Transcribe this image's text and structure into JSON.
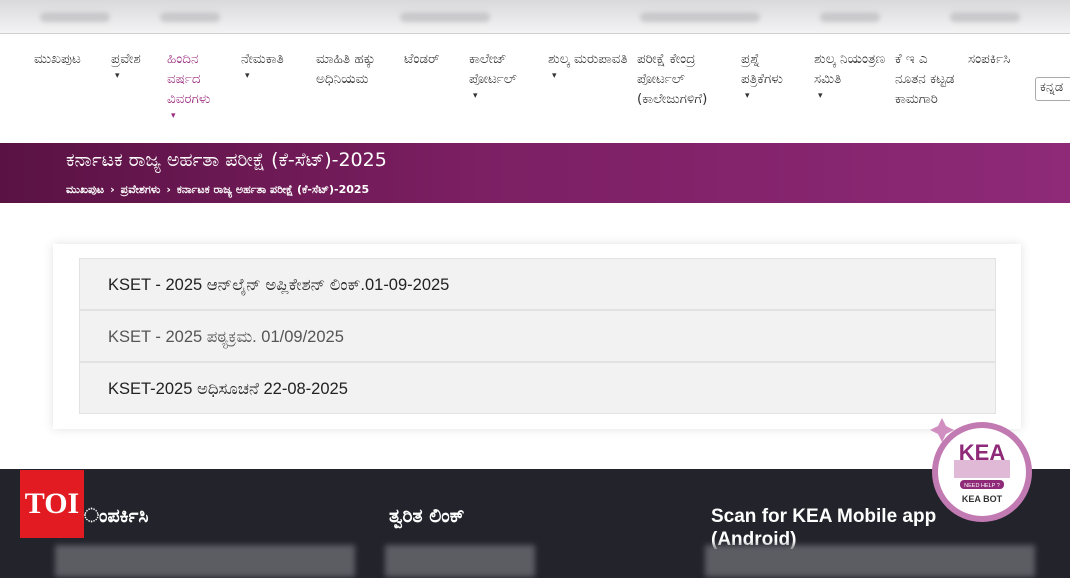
{
  "nav": {
    "items": [
      {
        "label": "ಮುಖಪುಟ",
        "caret": false
      },
      {
        "label": "ಪ್ರವೇಶ",
        "caret": true
      },
      {
        "label": "ಹಿಂದಿನ ವರ್ಷದ ವಿವರಗಳು",
        "caret": true
      },
      {
        "label": "ನೇಮಕಾತಿ",
        "caret": true
      },
      {
        "label": "ಮಾಹಿತಿ ಹಕ್ಕು ಅಧಿನಿಯಮ",
        "caret": false
      },
      {
        "label": "ಟೆಂಡರ್",
        "caret": false
      },
      {
        "label": "ಕಾಲೇಜ್ ಪೋರ್ಟಲ್",
        "caret": true
      },
      {
        "label": "ಶುಲ್ಕ ಮರುಪಾವತಿ",
        "caret": true
      },
      {
        "label": "ಪರೀಕ್ಷೆ ಕೇಂದ್ರ ಪೋರ್ಟಲ್ (ಕಾಲೇಜುಗಳಿಗೆ)",
        "caret": false
      },
      {
        "label": "ಪ್ರಶ್ನೆ ಪತ್ರಿಕೆಗಳು",
        "caret": true
      },
      {
        "label": "ಶುಲ್ಕ ನಿಯಂತ್ರಣ ಸಮಿತಿ",
        "caret": true
      },
      {
        "label": "ಕೆ ಇ ಎ ನೂತನ ಕಟ್ಟಡ ಕಾಮಗಾರಿ",
        "caret": false
      },
      {
        "label": "ಸಂಪರ್ಕಿಸಿ",
        "caret": false
      }
    ],
    "caret_glyph": "▾",
    "language_select": "ಕನ್ನಡ"
  },
  "banner": {
    "title": "ಕರ್ನಾಟಕ ರಾಜ್ಯ ಅರ್ಹತಾ ಪರೀಕ್ಷೆ (ಕೆ-ಸೆಟ್)-2025",
    "breadcrumb": [
      "ಮುಖಪುಟ",
      "ಪ್ರವೇಶಗಳು",
      "ಕರ್ನಾಟಕ ರಾಜ್ಯ ಅರ್ಹತಾ ಪರೀಕ್ಷೆ (ಕೆ-ಸೆಟ್)-2025"
    ],
    "breadcrumb_sep": "›"
  },
  "links": [
    "KSET - 2025 ಆನ್‌ಲೈನ್ ಅಪ್ಲಿಕೇಶನ್ ಲಿಂಕ್.01-09-2025",
    "KSET - 2025 ಪಠ್ಯಕ್ರಮ. 01/09/2025",
    "KSET-2025 ಅಧಿಸೂಚನೆ 22-08-2025"
  ],
  "footer": {
    "contact_heading": "ಂಪರ್ಕಿಸಿ",
    "quick_links_heading": "ತ್ವರಿತ ಲಿಂಕ್",
    "app_heading": "Scan for KEA Mobile app (Android)"
  },
  "overlay": {
    "toi_logo": "TOI",
    "kea_bot": {
      "letters": "KEA",
      "need_help": "NEED HELP ?",
      "name": "KEA BOT"
    }
  },
  "colors": {
    "banner": "#7c1f63",
    "active_nav": "#9b2d7f",
    "footer": "#22232b",
    "toi": "#e21b22"
  }
}
